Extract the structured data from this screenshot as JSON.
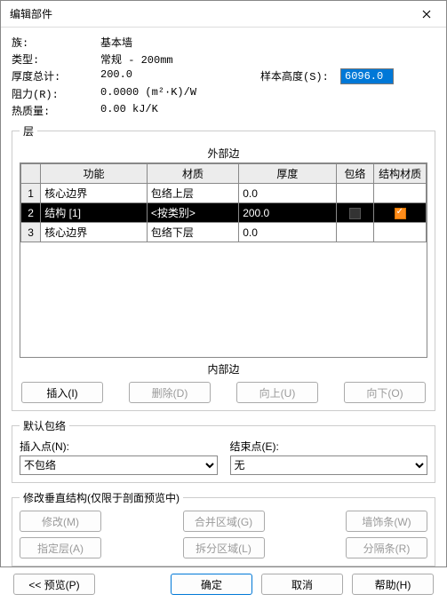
{
  "window": {
    "title": "编辑部件"
  },
  "props": {
    "family_label": "族:",
    "family_value": "基本墙",
    "type_label": "类型:",
    "type_value": "常规 - 200mm",
    "thickness_label": "厚度总计:",
    "thickness_value": "200.0",
    "sample_height_label": "样本高度(S):",
    "sample_height_value": "6096.0",
    "resistance_label": "阻力(R):",
    "resistance_value": "0.0000 (m²·K)/W",
    "thermal_label": "热质量:",
    "thermal_value": "0.00 kJ/K"
  },
  "layers": {
    "legend": "层",
    "outer_label": "外部边",
    "inner_label": "内部边",
    "headers": {
      "func": "功能",
      "mat": "材质",
      "thk": "厚度",
      "wrap": "包络",
      "struct": "结构材质"
    },
    "rows": [
      {
        "n": "1",
        "func": "核心边界",
        "mat": "包络上层",
        "thk": "0.0",
        "wrap": false,
        "struct": false,
        "sel": false
      },
      {
        "n": "2",
        "func": "结构 [1]",
        "mat": "<按类别>",
        "thk": "200.0",
        "wrap": false,
        "struct": true,
        "sel": true
      },
      {
        "n": "3",
        "func": "核心边界",
        "mat": "包络下层",
        "thk": "0.0",
        "wrap": false,
        "struct": false,
        "sel": false
      }
    ],
    "buttons": {
      "insert": "插入(I)",
      "delete": "删除(D)",
      "up": "向上(U)",
      "down": "向下(O)"
    }
  },
  "wraps": {
    "legend": "默认包络",
    "insert_label": "插入点(N):",
    "insert_value": "不包络",
    "end_label": "结束点(E):",
    "end_value": "无"
  },
  "vert": {
    "legend": "修改垂直结构(仅限于剖面预览中)",
    "modify": "修改(M)",
    "merge": "合并区域(G)",
    "sweep": "墙饰条(W)",
    "assign": "指定层(A)",
    "split": "拆分区域(L)",
    "reveal": "分隔条(R)"
  },
  "bottom": {
    "preview": "<< 预览(P)",
    "ok": "确定",
    "cancel": "取消",
    "help": "帮助(H)"
  }
}
